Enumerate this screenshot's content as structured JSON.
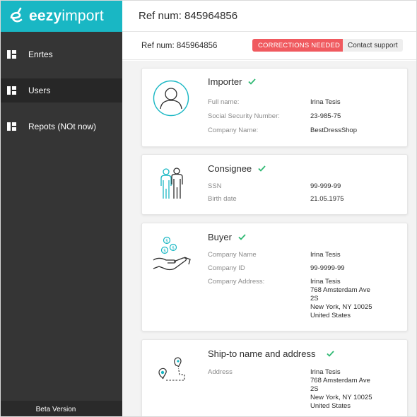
{
  "brand": {
    "name_bold": "eezy",
    "name_rest": "import",
    "accent": "#19b7c4"
  },
  "sidebar": {
    "items": [
      {
        "label": "Enrtes",
        "icon": "dashboard-icon",
        "active": false
      },
      {
        "label": "Users",
        "icon": "dashboard-icon",
        "active": true
      },
      {
        "label": "Repots (NOt now)",
        "icon": "dashboard-icon",
        "active": false
      }
    ],
    "footer": "Beta Version"
  },
  "header": {
    "title": "Ref num: 845964856"
  },
  "subheader": {
    "ref": "Ref num: 845964856",
    "status_badge": "CORRECTIONS NEEDED",
    "status_color": "#f05a5f",
    "support_label": "Contact support"
  },
  "cards": {
    "importer": {
      "title": "Importer",
      "fields": [
        {
          "label": "Full name:",
          "value": "Irina Tesis"
        },
        {
          "label": "Social Security Number:",
          "value": "23-985-75"
        },
        {
          "label": "Company Name:",
          "value": "BestDressShop"
        }
      ]
    },
    "consignee": {
      "title": "Consignee",
      "fields": [
        {
          "label": "SSN",
          "value": "99-999-99"
        },
        {
          "label": "Birth date",
          "value": "21.05.1975"
        }
      ]
    },
    "buyer": {
      "title": "Buyer",
      "fields": [
        {
          "label": "Company Name",
          "value": "Irina Tesis"
        },
        {
          "label": "Company ID",
          "value": "99-9999-99"
        },
        {
          "label": "Company Address:",
          "lines": [
            "Irina Tesis",
            "768 Amsterdam Ave",
            "2S",
            "New York, NY 10025",
            "United States"
          ]
        }
      ]
    },
    "shipto": {
      "title": "Ship-to name and address",
      "fields": [
        {
          "label": "Address",
          "lines": [
            "Irina Tesis",
            "768 Amsterdam Ave",
            "2S",
            "New York, NY 10025",
            "United States"
          ]
        }
      ]
    }
  },
  "check_color": "#2eb872"
}
